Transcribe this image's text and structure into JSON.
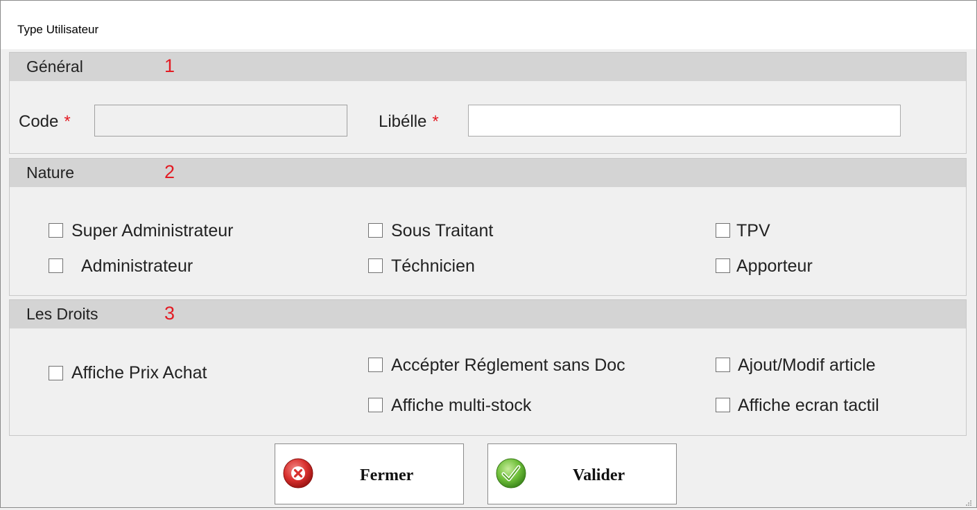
{
  "window": {
    "title": "Type Utilisateur"
  },
  "sections": {
    "general": {
      "title": "Général",
      "number": "1",
      "code_label": "Code",
      "code_required": "*",
      "code_value": "",
      "libelle_label": "Libélle",
      "libelle_required": "*",
      "libelle_value": ""
    },
    "nature": {
      "title": "Nature",
      "number": "2",
      "options": [
        {
          "label": "Super Administrateur",
          "checked": false
        },
        {
          "label": "Administrateur",
          "checked": false
        },
        {
          "label": "Sous Traitant",
          "checked": false
        },
        {
          "label": "Téchnicien",
          "checked": false
        },
        {
          "label": "TPV",
          "checked": false
        },
        {
          "label": "Apporteur",
          "checked": false
        }
      ]
    },
    "droits": {
      "title": "Les Droits",
      "number": "3",
      "options": [
        {
          "label": "Affiche Prix Achat",
          "checked": false
        },
        {
          "label": "Accépter Réglement sans Doc",
          "checked": false
        },
        {
          "label": "Affiche multi-stock",
          "checked": false
        },
        {
          "label": "Ajout/Modif article",
          "checked": false
        },
        {
          "label": "Affiche ecran tactil",
          "checked": false
        }
      ]
    }
  },
  "buttons": {
    "close_label": "Fermer",
    "close_icon": "close-x-icon",
    "validate_label": "Valider",
    "validate_icon": "checkmark-icon"
  },
  "colors": {
    "accent_red": "#e31b23",
    "section_header": "#d4d4d4",
    "close_red": "#d9302e",
    "validate_green": "#6fbf3a"
  }
}
